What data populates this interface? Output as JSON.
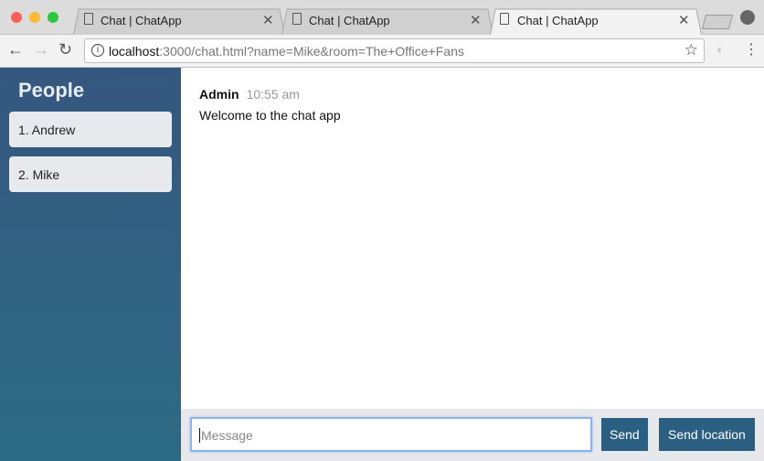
{
  "browser": {
    "tabs": [
      {
        "title": "Chat | ChatApp"
      },
      {
        "title": "Chat | ChatApp"
      },
      {
        "title": "Chat | ChatApp"
      }
    ],
    "url_host": "localhost",
    "url_rest": ":3000/chat.html?name=Mike&room=The+Office+Fans"
  },
  "sidebar": {
    "title": "People",
    "people": [
      "1. Andrew",
      "2. Mike"
    ]
  },
  "messages": [
    {
      "from": "Admin",
      "time": "10:55 am",
      "text": "Welcome to the chat app"
    }
  ],
  "form": {
    "placeholder": "Message",
    "send_label": "Send",
    "location_label": "Send location"
  },
  "colors": {
    "button": "#2b5f82",
    "sidebar_top": "#35577f",
    "sidebar_bottom": "#2c6b83"
  }
}
